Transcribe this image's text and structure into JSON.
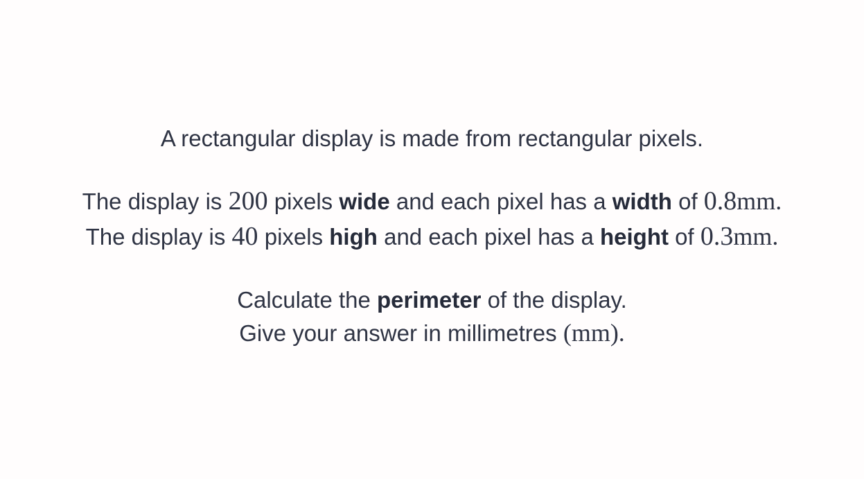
{
  "intro": {
    "text": "A rectangular display is made from rectangular pixels."
  },
  "width_line": {
    "prefix": "The display is",
    "count": "200",
    "mid1": "pixels",
    "bold1": "wide",
    "mid2": "and each pixel has a",
    "bold2": "width",
    "mid3": "of",
    "value": "0.8",
    "unit": "mm."
  },
  "height_line": {
    "prefix": "The display is",
    "count": "40",
    "mid1": "pixels",
    "bold1": "high",
    "mid2": "and each pixel has a",
    "bold2": "height",
    "mid3": "of",
    "value": "0.3",
    "unit": "mm."
  },
  "task": {
    "line1_prefix": "Calculate the",
    "line1_bold": "perimeter",
    "line1_suffix": "of the display.",
    "line2_prefix": "Give your answer in millimetres",
    "line2_unit": "(mm)."
  }
}
